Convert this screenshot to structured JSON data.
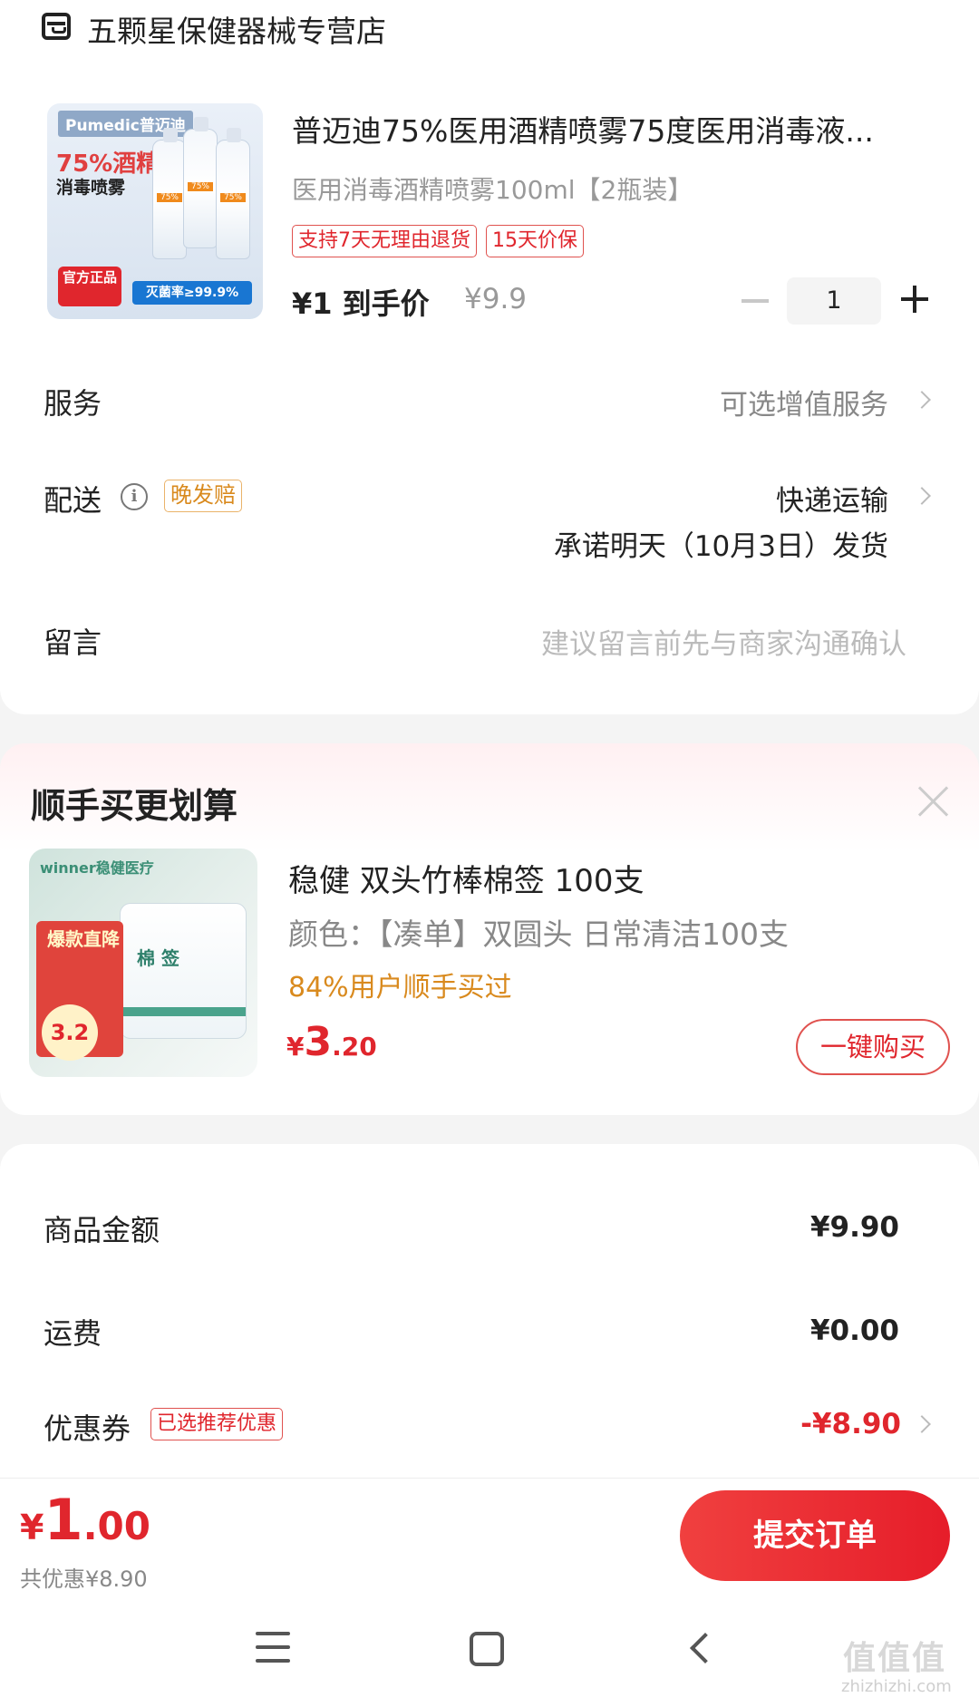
{
  "store": {
    "name": "五颗星保健器械专营店",
    "icon": "store-icon"
  },
  "product": {
    "title": "普迈迪75%医用酒精喷雾75度医用消毒液...",
    "variant": "医用消毒酒精喷雾100ml【2瓶装】",
    "tags": [
      "支持7天无理由退货",
      "15天价保"
    ],
    "price_label": "¥1 到手价",
    "original_price": "¥9.9",
    "quantity": "1",
    "image": {
      "brand_text": "Pumedic普迈迪",
      "headline": "75%酒精",
      "subline": "消毒喷雾",
      "badge_left": "官方正品",
      "badge_right": "灭菌率≥99.9%"
    }
  },
  "options": {
    "service": {
      "label": "服务",
      "value": "可选增值服务"
    },
    "delivery": {
      "label": "配送",
      "badge": "晚发赔",
      "method": "快递运输",
      "promise": "承诺明天（10月3日）发货"
    },
    "message": {
      "label": "留言",
      "placeholder": "建议留言前先与商家沟通确认"
    }
  },
  "recommendation": {
    "title": "顺手买更划算",
    "product_name": "稳健 双头竹棒棉签 100支",
    "variant": "颜色：【凑单】双圆头 日常清洁100支",
    "social_proof": "84%用户顺手买过",
    "price_currency": "¥",
    "price_int": "3",
    "price_dec": ".20",
    "buy_label": "一键购买",
    "image": {
      "brand_text": "winner稳健医疗",
      "burst_text": "爆款直降",
      "price_badge": "3.2"
    }
  },
  "summary": {
    "goods_label": "商品金额",
    "goods_value": "¥9.90",
    "shipping_label": "运费",
    "shipping_value": "¥0.00",
    "coupon_label": "优惠券",
    "coupon_tag": "已选推荐优惠",
    "coupon_value": "-¥8.90"
  },
  "bottom_bar": {
    "total_currency": "¥",
    "total_int": "1",
    "total_dec": ".00",
    "saved": "共优惠¥8.90",
    "submit_label": "提交订单"
  },
  "watermark": {
    "text": "值值值",
    "url": "zhizhizhi.com"
  },
  "colors": {
    "accent_red": "#e0262d",
    "orange": "#d98a1e",
    "gray_text": "#888888"
  }
}
